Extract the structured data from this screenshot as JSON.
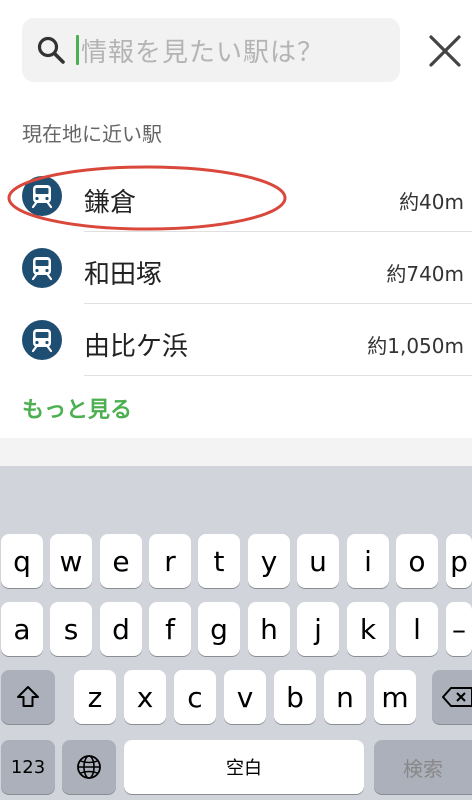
{
  "search": {
    "placeholder": "情報を見たい駅は？"
  },
  "nearby": {
    "title": "現在地に近い駅",
    "stations": [
      {
        "name": "鎌倉",
        "distance": "約40m"
      },
      {
        "name": "和田塚",
        "distance": "約740m"
      },
      {
        "name": "由比ケ浜",
        "distance": "約1,050m"
      }
    ],
    "more_label": "もっと見る"
  },
  "keyboard": {
    "row1": [
      "q",
      "w",
      "e",
      "r",
      "t",
      "y",
      "u",
      "i",
      "o",
      "p"
    ],
    "row2": [
      "a",
      "s",
      "d",
      "f",
      "g",
      "h",
      "j",
      "k",
      "l",
      "–"
    ],
    "row3": [
      "z",
      "x",
      "c",
      "v",
      "b",
      "n",
      "m"
    ],
    "numbers_label": "123",
    "space_label": "空白",
    "search_label": "検索"
  },
  "colors": {
    "accent": "#4caf50",
    "station_icon": "#1f4e73",
    "highlight": "#d9483b"
  },
  "icons": {
    "search": "search-icon",
    "close": "close-icon",
    "station": "train-icon",
    "shift": "shift-icon",
    "globe": "globe-icon",
    "delete": "delete-icon"
  }
}
